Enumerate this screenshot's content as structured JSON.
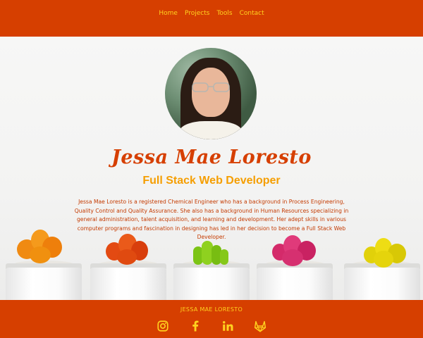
{
  "nav": {
    "items": [
      {
        "label": "Home"
      },
      {
        "label": "Projects"
      },
      {
        "label": "Tools"
      },
      {
        "label": "Contact"
      }
    ]
  },
  "profile": {
    "name": "Jessa Mae Loresto",
    "role": "Full Stack Web Developer",
    "bio": "Jessa Mae Loresto is a registered Chemical Engineer who has a background in Process Engineering, Quality Control and Quality Assurance. She also has a background in Human Resources specializing in general administration, talent acquisition, and learning and development. Her adept skills in various computer programs and fascination in designing has led in her decision to become a Full Stack Web Developer."
  },
  "footer": {
    "title": "JESSA MAE LORESTO",
    "socials": [
      {
        "icon": "instagram-icon"
      },
      {
        "icon": "facebook-icon"
      },
      {
        "icon": "linkedin-icon"
      },
      {
        "icon": "gitlab-icon"
      }
    ]
  },
  "colors": {
    "brand": "#d63f00",
    "accent": "#ffd21f",
    "role": "#f59e00"
  }
}
